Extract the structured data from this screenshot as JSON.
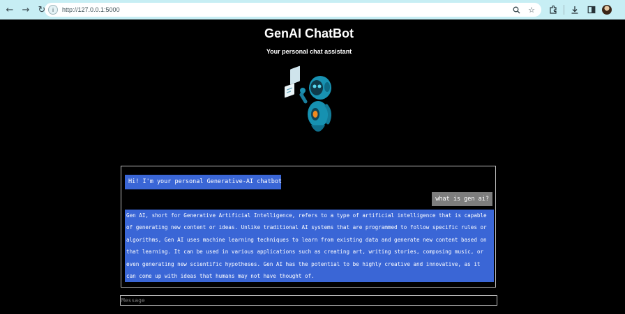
{
  "browser": {
    "url": "http://127.0.0.1:5000"
  },
  "page": {
    "title": "GenAI ChatBot",
    "subtitle": "Your personal chat assistant"
  },
  "chat": {
    "messages": [
      {
        "role": "bot",
        "text": "Hi! I'm your personal Generative-AI chatbot"
      },
      {
        "role": "user",
        "text": "what is gen ai?"
      },
      {
        "role": "bot",
        "text": "Gen AI, short for Generative Artificial Intelligence, refers to a type of artificial intelligence that is capable of generating new content or ideas. Unlike traditional AI systems that are programmed to follow specific rules or algorithms, Gen AI uses machine learning techniques to learn from existing data and generate new content based on that learning. It can be used in various applications such as creating art, writing stories, composing music, or even generating new scientific hypotheses. Gen AI has the potential to be highly creative and innovative, as it can come up with ideas that humans may not have thought of."
      }
    ]
  },
  "input": {
    "value": "",
    "placeholder": "Message"
  },
  "colors": {
    "background": "#000000",
    "bot_bubble": "#3a66d6",
    "user_bubble": "#7d7d7d",
    "browser_chrome": "#c7eef4"
  }
}
